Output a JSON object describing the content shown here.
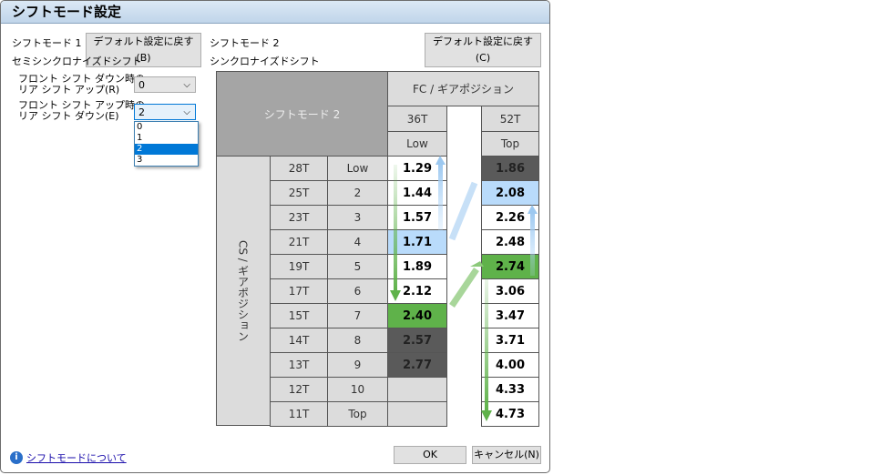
{
  "title": "シフトモード設定",
  "mode1": {
    "label": "シフトモード 1",
    "reset": "デフォルト設定に戻す(B)",
    "type": "セミシンクロナイズドシフト",
    "rear_up_label": [
      "フロント シフト ダウン時の",
      "リア シフト アップ(R)"
    ],
    "rear_up_value": "0",
    "rear_down_label": [
      "フロント シフト アップ時の",
      "リア シフト ダウン(E)"
    ],
    "rear_down_value": "2",
    "dropdown_options": [
      "0",
      "1",
      "2",
      "3"
    ],
    "dropdown_selected": "2"
  },
  "mode2": {
    "label": "シフトモード 2",
    "reset": "デフォルト設定に戻す(C)",
    "type": "シンクロナイズドシフト"
  },
  "table": {
    "corner": "シフトモード 2",
    "fc_header": "FC / ギアポジション",
    "cs_header": "CS / ギアポジション",
    "fc": [
      {
        "teeth": "36T",
        "pos": "Low"
      },
      {
        "teeth": "52T",
        "pos": "Top"
      }
    ],
    "rows": [
      {
        "teeth": "28T",
        "pos": "Low",
        "r36": "1.29",
        "s36": "w",
        "r52": "1.86",
        "s52": "dk"
      },
      {
        "teeth": "25T",
        "pos": "2",
        "r36": "1.44",
        "s36": "w",
        "r52": "2.08",
        "s52": "b"
      },
      {
        "teeth": "23T",
        "pos": "3",
        "r36": "1.57",
        "s36": "w",
        "r52": "2.26",
        "s52": "w"
      },
      {
        "teeth": "21T",
        "pos": "4",
        "r36": "1.71",
        "s36": "b",
        "r52": "2.48",
        "s52": "w"
      },
      {
        "teeth": "19T",
        "pos": "5",
        "r36": "1.89",
        "s36": "w",
        "r52": "2.74",
        "s52": "gr"
      },
      {
        "teeth": "17T",
        "pos": "6",
        "r36": "2.12",
        "s36": "w",
        "r52": "3.06",
        "s52": "w"
      },
      {
        "teeth": "15T",
        "pos": "7",
        "r36": "2.40",
        "s36": "gr",
        "r52": "3.47",
        "s52": "w"
      },
      {
        "teeth": "14T",
        "pos": "8",
        "r36": "2.57",
        "s36": "dk",
        "r52": "3.71",
        "s52": "w"
      },
      {
        "teeth": "13T",
        "pos": "9",
        "r36": "2.77",
        "s36": "dk",
        "r52": "4.00",
        "s52": "w"
      },
      {
        "teeth": "12T",
        "pos": "10",
        "r36": "",
        "s36": "g",
        "r52": "4.33",
        "s52": "w"
      },
      {
        "teeth": "11T",
        "pos": "Top",
        "r36": "",
        "s36": "g",
        "r52": "4.73",
        "s52": "w"
      }
    ]
  },
  "footer": {
    "help_link": "シフトモードについて",
    "ok": "OK",
    "cancel": "キャンセル(N)"
  }
}
